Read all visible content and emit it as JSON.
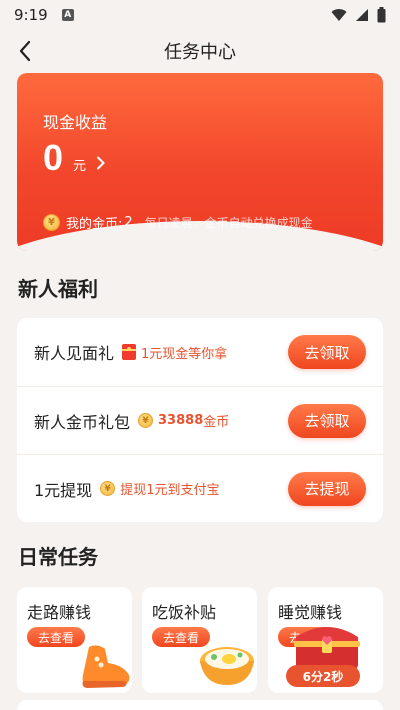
{
  "status_bar": {
    "time": "9:19",
    "app_badge": "A"
  },
  "nav": {
    "title": "任务中心"
  },
  "earnings": {
    "cash_label": "现金收益",
    "cash_amount": "0",
    "cash_unit": "元",
    "coin_label": "我的金币:",
    "coin_value": "2",
    "coin_note": "每日凌晨，金币自动兑换成现金"
  },
  "newbie": {
    "title": "新人福利",
    "items": [
      {
        "name": "新人见面礼",
        "tag": "1元现金等你拿",
        "button": "去领取"
      },
      {
        "name": "新人金币礼包",
        "tag_amount": "33888",
        "tag_suffix": "金币",
        "button": "去领取"
      },
      {
        "name": "1元提现",
        "tag": "提现1元到支付宝",
        "button": "去提现"
      }
    ]
  },
  "daily": {
    "title": "日常任务",
    "items": [
      {
        "name": "走路赚钱",
        "button": "去查看"
      },
      {
        "name": "吃饭补贴",
        "button": "去查看"
      },
      {
        "name": "睡觉赚钱",
        "button": "去查看",
        "countdown": "6分2秒"
      }
    ]
  },
  "colors": {
    "accent": "#f0461f",
    "card_top": "#ff6a3d",
    "card_bottom": "#ee3b26",
    "background": "#f5f2ef"
  },
  "icons": [
    "back-arrow-icon",
    "wifi-icon",
    "signal-icon",
    "battery-icon",
    "chevron-right-icon",
    "coin-icon",
    "red-packet-icon",
    "shoe-icon",
    "rice-bowl-icon",
    "treasure-chest-icon"
  ]
}
